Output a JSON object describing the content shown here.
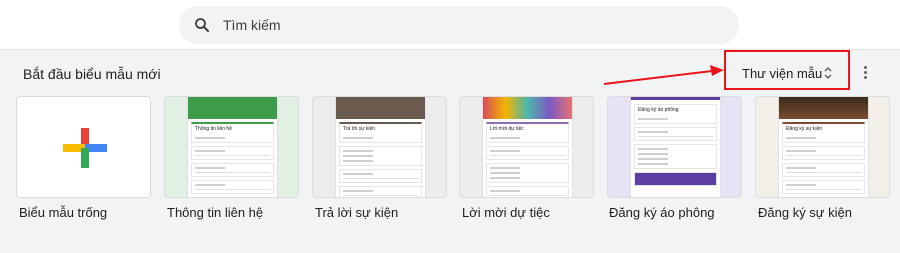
{
  "search": {
    "placeholder": "Tìm kiếm"
  },
  "section": {
    "title": "Bắt đầu biểu mẫu mới",
    "gallery_label": "Thư viện mẫu"
  },
  "templates": [
    {
      "label": "Biểu mẫu trống"
    },
    {
      "label": "Thông tin liên hệ",
      "preview_title": "Thông tin liên hệ",
      "theme_color": "#3c9c49",
      "background": "#e1f0e3"
    },
    {
      "label": "Trả lời sự kiện",
      "preview_title": "Trả lời sự kiện",
      "theme_color": "#6b5a4e",
      "background": "#ececec"
    },
    {
      "label": "Lời mời dự tiệc",
      "preview_title": "Lời mời dự tiệc",
      "theme_color": "#8d6fb4",
      "background": "#ececec"
    },
    {
      "label": "Đăng ký áo phông",
      "preview_title": "Đăng ký áo phông",
      "theme_color": "#5b3ea0",
      "background": "#e8e3f4"
    },
    {
      "label": "Đăng ký sự kiện",
      "preview_title": "Đăng ký sự kiện",
      "theme_color": "#7a4b2e",
      "background": "#f3efe9"
    }
  ],
  "colors": {
    "highlight": "#e8161b",
    "plus_blue": "#4285f4",
    "plus_red": "#ea4335",
    "plus_yellow": "#fbbc04",
    "plus_green": "#34a853"
  }
}
